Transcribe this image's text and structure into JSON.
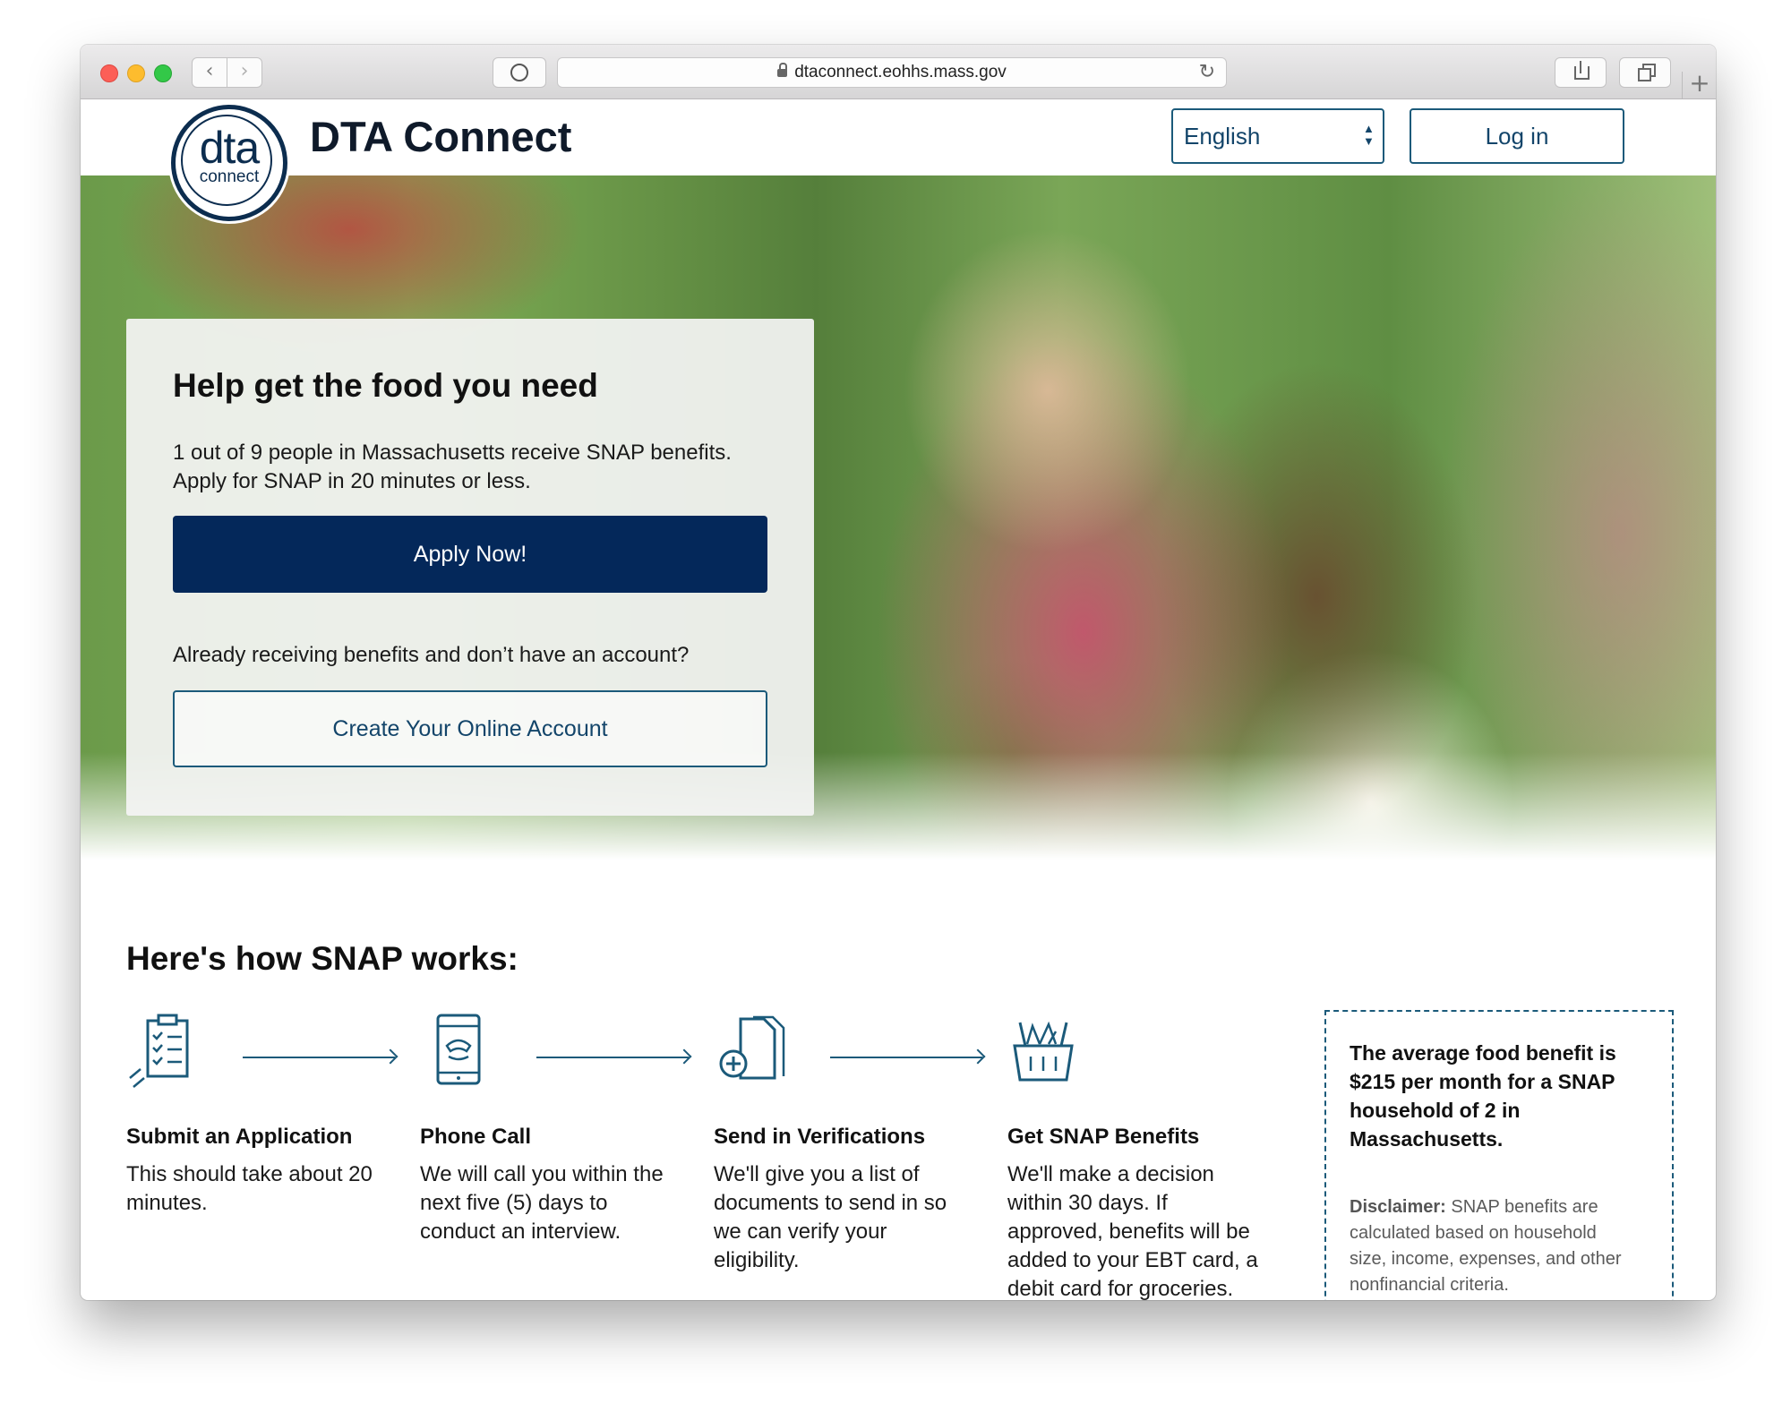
{
  "browser": {
    "url": "dtaconnect.eohhs.mass.gov",
    "back_icon": "‹",
    "forward_icon": "›",
    "reload_icon": "↻",
    "new_tab_icon": "+"
  },
  "header": {
    "logo_main": "dta",
    "logo_sub": "connect",
    "brand": "DTA Connect",
    "language": "English",
    "login_label": "Log in"
  },
  "hero": {
    "title": "Help get the food you need",
    "text_line1": "1 out of 9 people in Massachusetts receive SNAP benefits.",
    "text_line2": "Apply for SNAP in 20 minutes or less.",
    "apply_label": "Apply Now!",
    "already_text": "Already receiving benefits and don’t have an account?",
    "create_label": "Create Your Online Account"
  },
  "how": {
    "title": "Here's how SNAP works:",
    "steps": [
      {
        "icon": "clipboard-icon",
        "title": "Submit an Application",
        "lines": [
          "This should take about 20",
          "minutes."
        ]
      },
      {
        "icon": "phone-icon",
        "title": "Phone Call",
        "lines": [
          "We will call you within the",
          "next five (5) days to",
          "conduct an interview."
        ]
      },
      {
        "icon": "document-plus-icon",
        "title": "Send in Verifications",
        "lines": [
          "We'll give you a list of",
          "documents to send in so",
          "we can verify your",
          "eligibility."
        ]
      },
      {
        "icon": "grocery-basket-icon",
        "title": "Get SNAP Benefits",
        "lines": [
          "We'll make a decision",
          "within 30 days. If",
          "approved, benefits will be",
          "added to your EBT card, a",
          "debit card for groceries."
        ]
      }
    ]
  },
  "info": {
    "main_lines": [
      "The average food benefit is",
      "$215 per month for a SNAP",
      "household of 2 in",
      "Massachusetts."
    ],
    "disclaimer_label": "Disclaimer:",
    "disclaimer_lines": [
      " SNAP benefits are",
      "calculated based on household",
      "size, income, expenses, and other",
      "nonfinancial criteria."
    ]
  },
  "colors": {
    "navy": "#04285a",
    "accent_border": "#1b5a7a"
  }
}
